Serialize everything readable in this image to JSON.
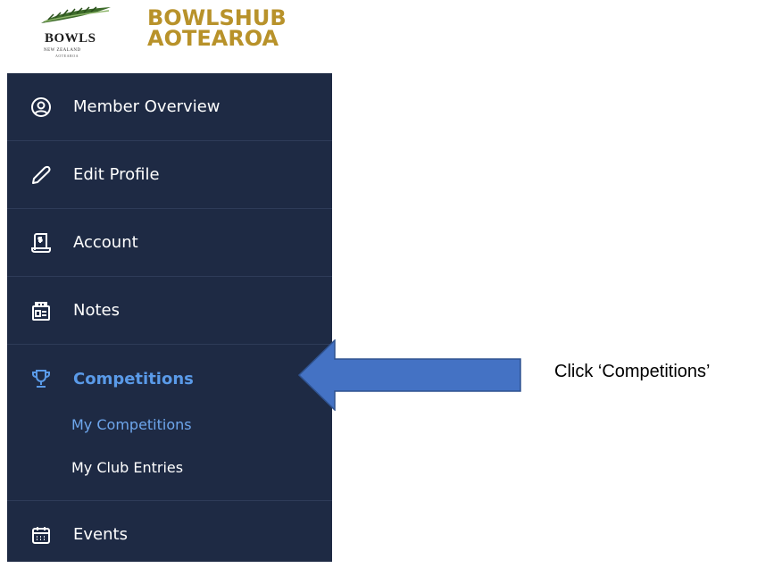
{
  "logo": {
    "brand_line1": "BOWLSHUB",
    "brand_line2": "AOTEAROA",
    "bowls": "BOWLS",
    "nz": "NEW ZEALAND",
    "aotearoa_small": "AOTEAROA"
  },
  "sidebar": {
    "items": [
      {
        "label": "Member Overview",
        "icon": "user-circle-icon"
      },
      {
        "label": "Edit Profile",
        "icon": "pencil-icon"
      },
      {
        "label": "Account",
        "icon": "receipt-icon"
      },
      {
        "label": "Notes",
        "icon": "notebook-icon"
      }
    ],
    "competitions": {
      "label": "Competitions",
      "icon": "trophy-icon",
      "sub": [
        "My Competitions",
        "My Club Entries"
      ]
    },
    "events": {
      "label": "Events",
      "icon": "calendar-icon"
    }
  },
  "annotation": {
    "caption": "Click ‘Competitions’"
  },
  "colors": {
    "sidebar_bg": "#1e2a44",
    "active": "#5a9ae8",
    "brand_gold": "#b8922a",
    "arrow_fill": "#4472c4"
  }
}
